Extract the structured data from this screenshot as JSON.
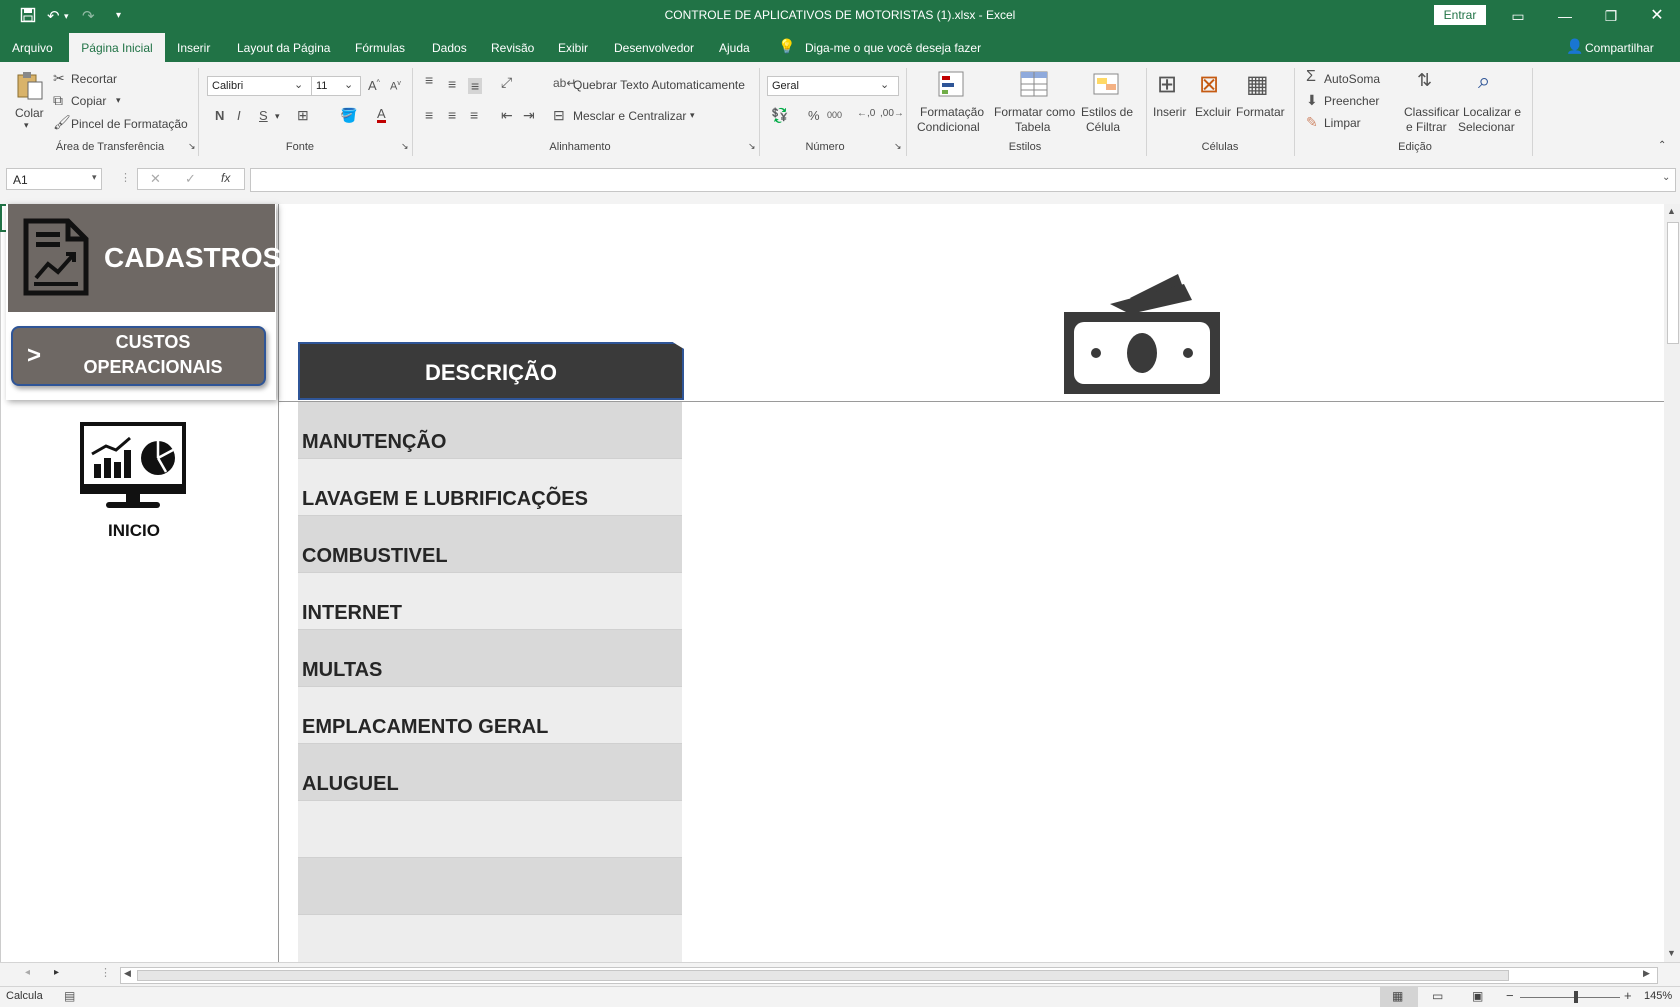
{
  "window": {
    "title": "CONTROLE DE APLICATIVOS DE MOTORISTAS (1).xlsx  -  Excel",
    "signin": "Entrar"
  },
  "menu": {
    "items": [
      "Arquivo",
      "Página Inicial",
      "Inserir",
      "Layout da Página",
      "Fórmulas",
      "Dados",
      "Revisão",
      "Exibir",
      "Desenvolvedor",
      "Ajuda"
    ],
    "search": "Diga-me o que você deseja fazer",
    "share": "Compartilhar"
  },
  "ribbon": {
    "clipboard": {
      "paste": "Colar",
      "cut": "Recortar",
      "copy": "Copiar",
      "format_painter": "Pincel de Formatação",
      "group": "Área de Transferência"
    },
    "font": {
      "name": "Calibri",
      "size": "11",
      "bold": "N",
      "italic": "I",
      "underline": "S",
      "font_color": "A",
      "group": "Fonte"
    },
    "alignment": {
      "wrap": "Quebrar Texto Automaticamente",
      "merge": "Mesclar e Centralizar",
      "group": "Alinhamento"
    },
    "number": {
      "format": "Geral",
      "percent": "%",
      "thousands": "000",
      "group": "Número"
    },
    "styles": {
      "cond1": "Formatação",
      "cond2": "Condicional",
      "table1": "Formatar como",
      "table2": "Tabela",
      "cell1": "Estilos de",
      "cell2": "Célula",
      "group": "Estilos"
    },
    "cells": {
      "insert": "Inserir",
      "delete": "Excluir",
      "format": "Formatar",
      "group": "Células"
    },
    "editing": {
      "autosum": "AutoSoma",
      "fill": "Preencher",
      "clear": "Limpar",
      "sort1": "Classificar",
      "sort2": "e Filtrar",
      "find1": "Localizar e",
      "find2": "Selecionar",
      "group": "Edição"
    }
  },
  "formula_bar": {
    "name_box": "A1",
    "fx": "fx",
    "value": ""
  },
  "sheet": {
    "panel_title": "CADASTROS",
    "button_arrow": ">",
    "button_line1": "CUSTOS",
    "button_line2": "OPERACIONAIS",
    "home_label": "INICIO",
    "header": "DESCRIÇÃO",
    "rows": [
      "MANUTENÇÃO",
      "LAVAGEM E LUBRIFICAÇÕES",
      "COMBUSTIVEL",
      "INTERNET",
      "MULTAS",
      "EMPLACAMENTO GERAL",
      "ALUGUEL",
      "",
      ""
    ]
  },
  "status": {
    "mode": "Calcula",
    "zoom": "145%"
  },
  "colors": {
    "excel_green": "#217346",
    "panel_gray": "#6e6864",
    "row_dark": "#d9d9d9",
    "row_light": "#ededed",
    "header_dark": "#3a3a3a"
  }
}
